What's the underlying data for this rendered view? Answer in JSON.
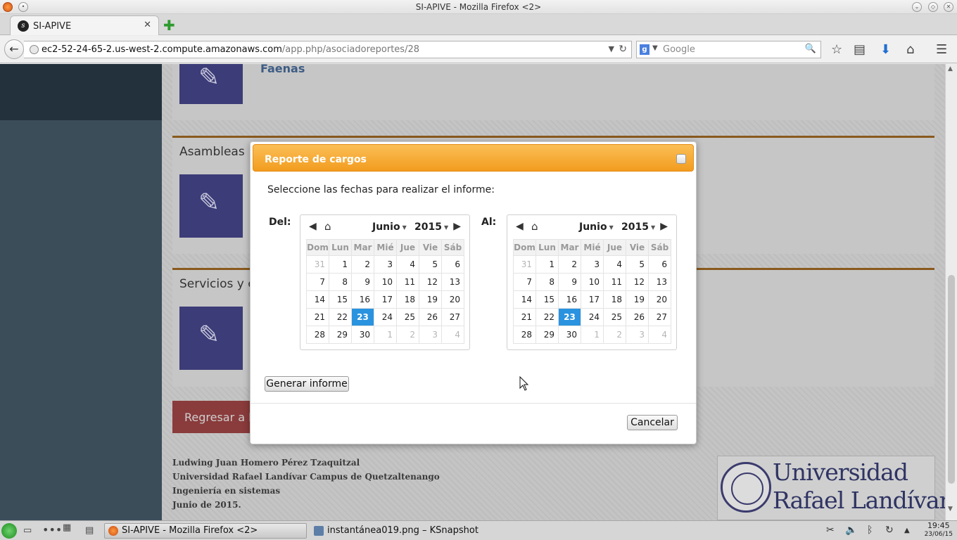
{
  "window": {
    "title": "SI-APIVE - Mozilla Firefox <2>"
  },
  "tabs": [
    {
      "label": "SI-APIVE"
    }
  ],
  "navbar": {
    "url_host": "ec2-52-24-65-2.us-west-2.compute.amazonaws.com",
    "url_path": "/app.php/asociadoreportes/28",
    "search_placeholder": "Google"
  },
  "page": {
    "sections": {
      "faenas": {
        "link": "Faenas"
      },
      "asambleas": {
        "title": "Asambleas"
      },
      "servicios": {
        "title": "Servicios y ca"
      }
    },
    "back_button": "Regresar a la",
    "footer": [
      "Ludwing Juan Homero Pérez Tzaquitzal",
      "Universidad Rafael Landívar Campus de Quetzaltenango",
      "Ingeniería en sistemas",
      "Junio de 2015."
    ],
    "logo": {
      "line1": "Universidad",
      "line2": "Rafael Landívar"
    }
  },
  "dialog": {
    "title": "Reporte de cargos",
    "instruction": "Seleccione las fechas para realizar el informe:",
    "from_label": "Del:",
    "to_label": "Al:",
    "generate_button": "Generar informe",
    "cancel_button": "Cancelar",
    "accent_color": "#f29c1f",
    "selected_color": "#2a93df"
  },
  "calendar": {
    "month": "Junio",
    "year": "2015",
    "weekdays": [
      "Dom",
      "Lun",
      "Mar",
      "Mié",
      "Jue",
      "Vie",
      "Sáb"
    ],
    "weeks": [
      [
        "31",
        "1",
        "2",
        "3",
        "4",
        "5",
        "6"
      ],
      [
        "7",
        "8",
        "9",
        "10",
        "11",
        "12",
        "13"
      ],
      [
        "14",
        "15",
        "16",
        "17",
        "18",
        "19",
        "20"
      ],
      [
        "21",
        "22",
        "23",
        "24",
        "25",
        "26",
        "27"
      ],
      [
        "28",
        "29",
        "30",
        "1",
        "2",
        "3",
        "4"
      ]
    ],
    "selected_day": "23"
  },
  "taskbar": {
    "tasks": [
      {
        "label": "SI-APIVE - Mozilla Firefox <2>"
      },
      {
        "label": "instantánea019.png – KSnapshot"
      }
    ],
    "clock_time": "19:45",
    "clock_date": "23/06/15"
  }
}
